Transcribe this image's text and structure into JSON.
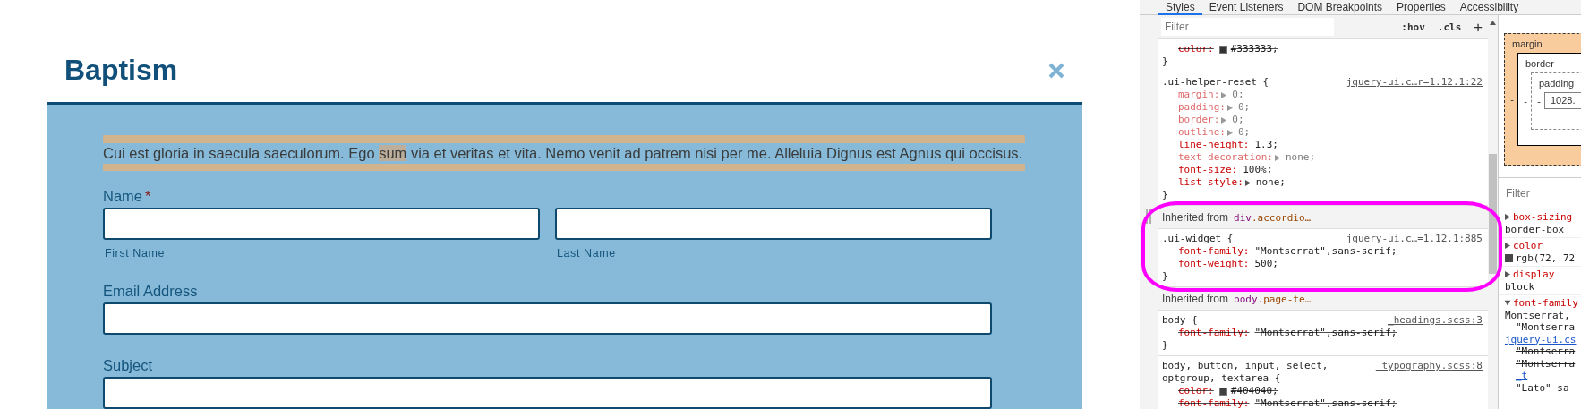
{
  "dialog": {
    "title": "Baptism",
    "notice": [
      {
        "text": "Cui est gloria in saecula saeculorum. Ego ",
        "highlighted": false
      },
      {
        "text": "sum",
        "highlighted": true
      },
      {
        "text": " via et veritas et vita. Nemo venit ad patrem nisi per me. Alleluia Dignus est Agnus qui occisus.",
        "highlighted": false
      }
    ],
    "fields": [
      {
        "kind": "name",
        "label": "Name",
        "required_mark": "*",
        "parts": [
          {
            "caption": "First Name"
          },
          {
            "caption": "Last Name"
          }
        ]
      },
      {
        "kind": "text",
        "label": "Email Address"
      },
      {
        "kind": "text",
        "label": "Subject"
      }
    ]
  },
  "devtools": {
    "tabs": [
      {
        "label": "Styles",
        "selected": true
      },
      {
        "label": "Event Listeners",
        "selected": false
      },
      {
        "label": "DOM Breakpoints",
        "selected": false
      },
      {
        "label": "Properties",
        "selected": false
      },
      {
        "label": "Accessibility",
        "selected": false
      }
    ],
    "filter": {
      "placeholder": "Filter"
    },
    "toggles": [
      ":hov",
      ".cls",
      "+"
    ],
    "blocks": [
      {
        "kind": "rule",
        "declarations": [
          {
            "property": "color:",
            "value": "#333333;",
            "color": "#333333",
            "overridden": true
          }
        ],
        "close": "}"
      },
      {
        "kind": "rule",
        "selector": [
          ".ui-helper-reset {"
        ],
        "source": "jquery-ui.c…r=1.12.1:22",
        "declarations": [
          {
            "property": "margin:",
            "value": "0;",
            "expandable": true,
            "inactive": true
          },
          {
            "property": "padding:",
            "value": "0;",
            "expandable": true,
            "inactive": true
          },
          {
            "property": "border:",
            "value": "0;",
            "expandable": true,
            "inactive": true
          },
          {
            "property": "outline:",
            "value": "0;",
            "expandable": true,
            "inactive": true
          },
          {
            "property": "line-height:",
            "value": "1.3;"
          },
          {
            "property": "text-decoration:",
            "value": "none;",
            "expandable": true,
            "inactive": true
          },
          {
            "property": "font-size:",
            "value": "100%;"
          },
          {
            "property": "list-style:",
            "value": "none;",
            "expandable": true
          }
        ],
        "close": "}"
      },
      {
        "kind": "inherited",
        "label": "Inherited from",
        "tag": "div",
        "classes": ".accordio…",
        "circled": true
      },
      {
        "kind": "rule",
        "circled": true,
        "selector": [
          ".ui-widget {"
        ],
        "source": "jquery-ui.c…=1.12.1:885",
        "declarations": [
          {
            "property": "font-family:",
            "value": "\"Montserrat\",sans-serif;"
          },
          {
            "property": "font-weight:",
            "value": "500;"
          }
        ],
        "close": "}"
      },
      {
        "kind": "inherited",
        "label": "Inherited from",
        "tag": "body",
        "classes": ".page-te…"
      },
      {
        "kind": "rule",
        "selector": [
          "body {"
        ],
        "source": "_headings.scss:3",
        "declarations": [
          {
            "property": "font-family:",
            "value": "\"Montserrat\",sans-serif;",
            "overridden": true
          }
        ],
        "close": "}"
      },
      {
        "kind": "rule",
        "selector": [
          "body, button, input, select,",
          "optgroup, textarea {"
        ],
        "source": "_typography.scss:8",
        "declarations": [
          {
            "property": "color:",
            "value": "#404040;",
            "color": "#404040",
            "overridden": true
          },
          {
            "property": "font-family:",
            "value": "\"Montserrat\",sans-serif;",
            "overridden": true
          }
        ]
      }
    ],
    "box_model": {
      "margin": "margin",
      "border": "border",
      "padding": "padding",
      "content": "1028.",
      "margin_left": "-",
      "border_left": "-",
      "padding_left": "-"
    },
    "computed_filter": {
      "placeholder": "Filter"
    },
    "computed": [
      {
        "property": "box-sizing",
        "expanded": false,
        "values": [
          {
            "text": "border-box"
          }
        ]
      },
      {
        "property": "color",
        "expanded": false,
        "values": [
          {
            "text": "rgb(72, 72",
            "color": "#484848"
          }
        ]
      },
      {
        "property": "display",
        "expanded": false,
        "values": [
          {
            "text": "block"
          }
        ]
      },
      {
        "property": "font-family",
        "expanded": true,
        "values": [
          {
            "text": "Montserrat,"
          },
          {
            "text": "\"Montserra",
            "indent": true
          },
          {
            "text": "jquery-ui.cs",
            "link": true
          },
          {
            "text": "\"Montserra",
            "indent": true,
            "overridden": true
          },
          {
            "text": "\"Montserra",
            "indent": true,
            "overridden": true
          },
          {
            "text": "_t",
            "link": true,
            "indent": true
          },
          {
            "text": "\"Lato\" sa",
            "indent": true
          }
        ]
      }
    ]
  }
}
